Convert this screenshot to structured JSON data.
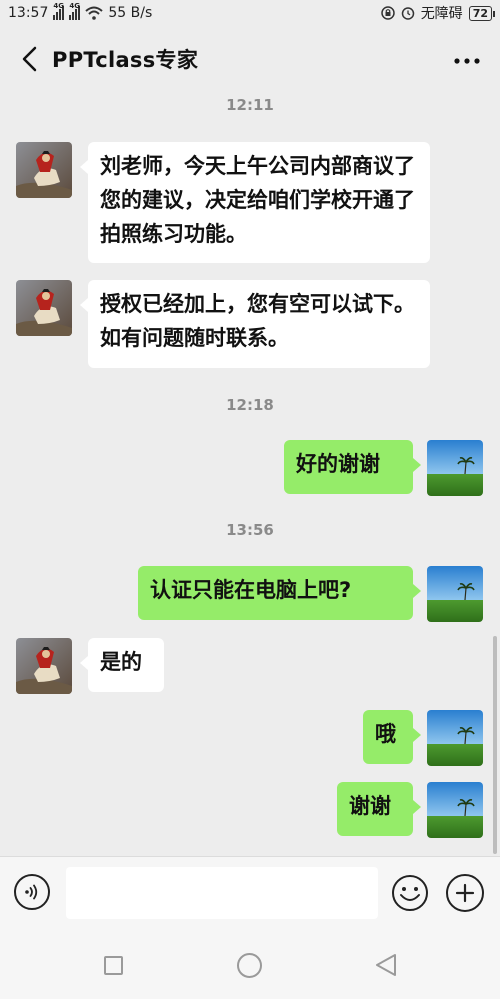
{
  "status_bar": {
    "time": "13:57",
    "network_1": "4G",
    "network_2": "4G",
    "speed": "55 B/s",
    "accessibility": "无障碍",
    "battery": "72"
  },
  "header": {
    "title": "PPTclass专家"
  },
  "timestamps": [
    "12:11",
    "12:18",
    "13:56"
  ],
  "messages": [
    {
      "side": "left",
      "text": "刘老师，今天上午公司内部商议了您的建议，决定给咱们学校开通了拍照练习功能。",
      "avatar": "napoleon-avatar"
    },
    {
      "side": "left",
      "text": "授权已经加上，您有空可以试下。如有问题随时联系。",
      "avatar": "napoleon-avatar"
    },
    {
      "side": "right",
      "text": "好的谢谢",
      "avatar": "palm-beach-avatar"
    },
    {
      "side": "right",
      "text": "认证只能在电脑上吧?",
      "avatar": "palm-beach-avatar"
    },
    {
      "side": "left",
      "text": "是的",
      "avatar": "napoleon-avatar"
    },
    {
      "side": "right",
      "text": "哦",
      "avatar": "palm-beach-avatar"
    },
    {
      "side": "right",
      "text": "谢谢",
      "avatar": "palm-beach-avatar"
    }
  ],
  "input": {
    "value": "",
    "placeholder": ""
  },
  "colors": {
    "background": "#ededed",
    "bubble_sent": "#95ec69",
    "bubble_received": "#ffffff"
  }
}
